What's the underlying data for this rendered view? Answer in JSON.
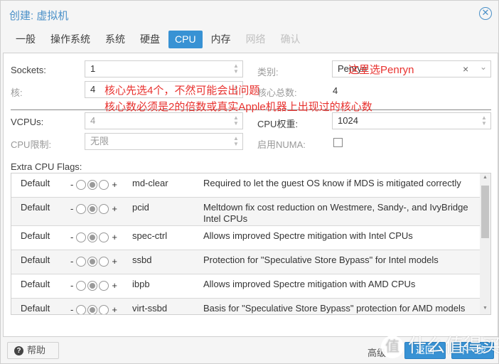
{
  "window": {
    "title": "创建: 虚拟机",
    "close_icon": "close-circle-icon"
  },
  "tabs": [
    {
      "label": "一般",
      "state": "normal"
    },
    {
      "label": "操作系统",
      "state": "normal"
    },
    {
      "label": "系统",
      "state": "normal"
    },
    {
      "label": "硬盘",
      "state": "normal"
    },
    {
      "label": "CPU",
      "state": "active"
    },
    {
      "label": "内存",
      "state": "normal"
    },
    {
      "label": "网络",
      "state": "disabled"
    },
    {
      "label": "确认",
      "state": "disabled"
    }
  ],
  "form": {
    "sockets": {
      "label": "Sockets:",
      "value": "1"
    },
    "cores": {
      "label": "核:",
      "value": "4"
    },
    "type": {
      "label": "类别:",
      "value": "Penryn"
    },
    "total_cores": {
      "label": "核心总数:",
      "value": "4"
    },
    "vcpus": {
      "label": "VCPUs:",
      "value": "4"
    },
    "cpu_weight": {
      "label": "CPU权重:",
      "value": "1024"
    },
    "cpu_limit": {
      "label": "CPU限制:",
      "value": "无限"
    },
    "numa": {
      "label": "启用NUMA:",
      "checked": false
    },
    "spin_up": "▲",
    "spin_down": "▼",
    "clear_glyph": "×",
    "dropdown_glyph": "⌄"
  },
  "annotations": {
    "type_note": "这里选Penryn",
    "cores_note": "核心先选4个，不然可能会出问题",
    "cores_note2": "核心数必须是2的倍数或真实Apple机器上出现过的核心数",
    "color": "#e8322f"
  },
  "flags": {
    "label": "Extra CPU Flags:",
    "minus": "-",
    "plus": "+",
    "rows": [
      {
        "state": "Default",
        "flag": "md-clear",
        "desc": "Required to let the guest OS know if MDS is mitigated correctly"
      },
      {
        "state": "Default",
        "flag": "pcid",
        "desc": "Meltdown fix cost reduction on Westmere, Sandy-, and IvyBridge Intel CPUs"
      },
      {
        "state": "Default",
        "flag": "spec-ctrl",
        "desc": "Allows improved Spectre mitigation with Intel CPUs"
      },
      {
        "state": "Default",
        "flag": "ssbd",
        "desc": "Protection for \"Speculative Store Bypass\" for Intel models"
      },
      {
        "state": "Default",
        "flag": "ibpb",
        "desc": "Allows improved Spectre mitigation with AMD CPUs"
      },
      {
        "state": "Default",
        "flag": "virt-ssbd",
        "desc": "Basis for \"Speculative Store Bypass\" protection for AMD models"
      }
    ],
    "scroll_up": "▲",
    "scroll_down": "▼"
  },
  "footer": {
    "help_label": "帮助",
    "help_icon": "?",
    "advanced_label": "高级",
    "back_label": "返回",
    "next_label": "下一步"
  },
  "watermark": {
    "badge": "值",
    "text": "什么值得买"
  },
  "colors": {
    "accent": "#3892d4",
    "title": "#4a90c8"
  }
}
